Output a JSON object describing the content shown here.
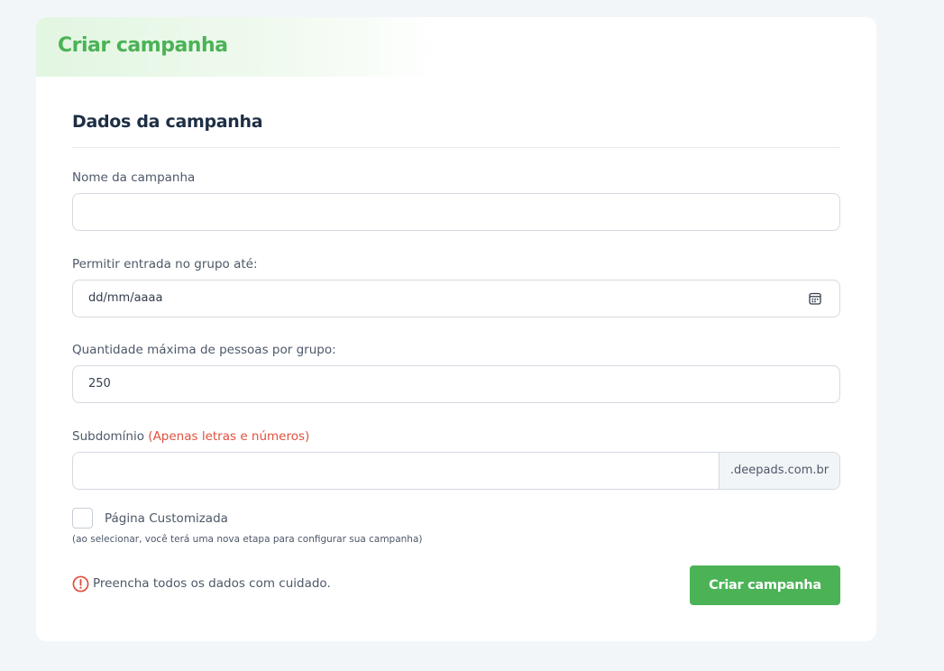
{
  "header": {
    "title": "Criar campanha"
  },
  "section": {
    "title": "Dados da campanha"
  },
  "form": {
    "campaign_name": {
      "label": "Nome da campanha",
      "value": ""
    },
    "entry_until": {
      "label": "Permitir entrada no grupo até:",
      "value": "dd/mm/aaaa",
      "icon": "calendar-icon"
    },
    "max_people": {
      "label": "Quantidade máxima de pessoas por grupo:",
      "value": "250"
    },
    "subdomain": {
      "label": "Subdomínio",
      "hint": "(Apenas letras e números)",
      "value": "",
      "suffix": ".deepads.com.br"
    },
    "custom_page": {
      "label": "Página Customizada",
      "note": "(ao selecionar, você terá uma nova etapa para configurar sua campanha)",
      "checked": false
    }
  },
  "footer": {
    "warning_text": "Preencha todos os dados com cuidado.",
    "warning_icon": "alert-circle-icon",
    "submit_label": "Criar campanha"
  },
  "colors": {
    "brand_green": "#4bb356",
    "warning_red": "#e0513f",
    "heading": "#1e2f45",
    "page_background": "#f3f6f9"
  }
}
